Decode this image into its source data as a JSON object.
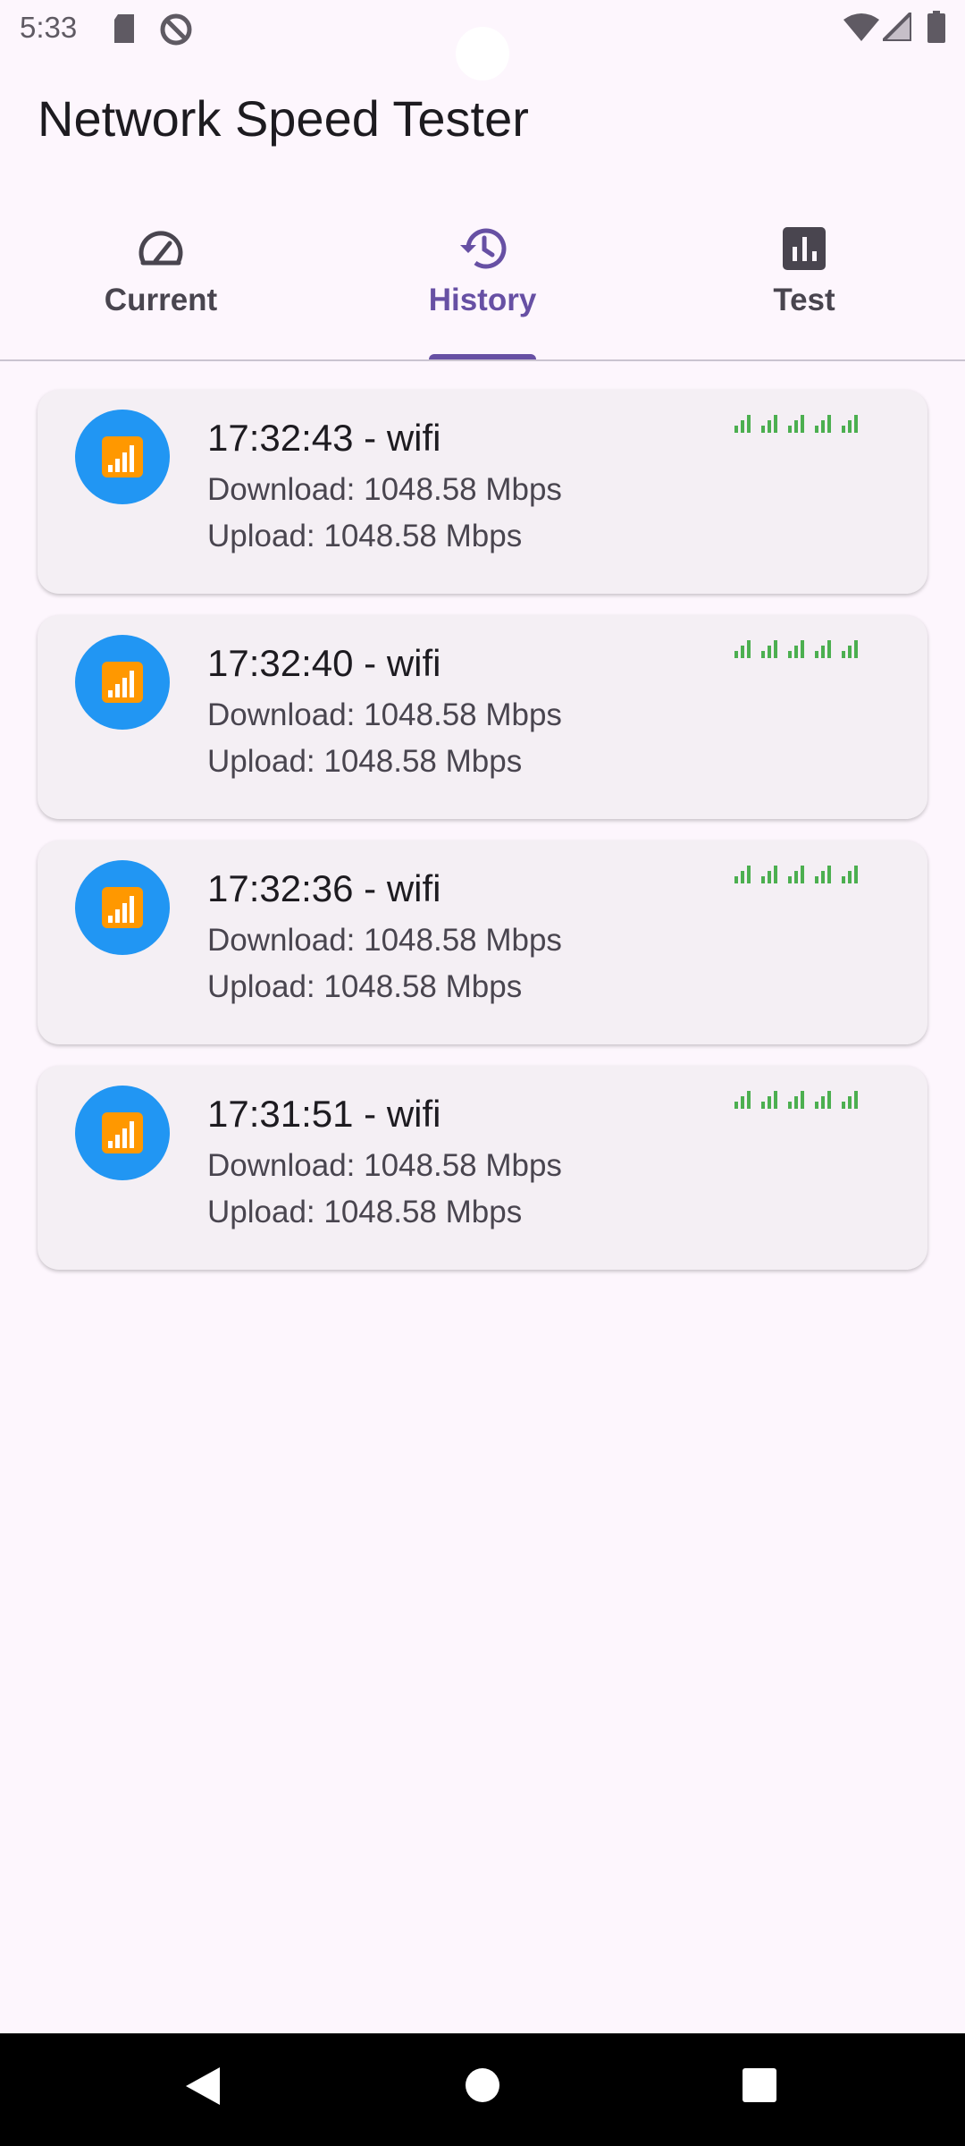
{
  "status_bar": {
    "time": "5:33",
    "icons": [
      "sd-card-icon",
      "do-not-disturb-icon",
      "wifi-icon",
      "cell-signal-icon",
      "battery-icon"
    ]
  },
  "app": {
    "title": "Network Speed Tester"
  },
  "tabs": [
    {
      "label": "Current",
      "icon": "speedometer-icon",
      "active": false
    },
    {
      "label": "History",
      "icon": "history-icon",
      "active": true
    },
    {
      "label": "Test",
      "icon": "bar-chart-icon",
      "active": false
    }
  ],
  "history": [
    {
      "title": "17:32:43 - wifi",
      "download": "Download: 1048.58 Mbps",
      "upload": "Upload: 1048.58 Mbps",
      "icon": "signal-bars-icon"
    },
    {
      "title": "17:32:40 - wifi",
      "download": "Download: 1048.58 Mbps",
      "upload": "Upload: 1048.58 Mbps",
      "icon": "signal-bars-icon"
    },
    {
      "title": "17:32:36 - wifi",
      "download": "Download: 1048.58 Mbps",
      "upload": "Upload: 1048.58 Mbps",
      "icon": "signal-bars-icon"
    },
    {
      "title": "17:31:51 - wifi",
      "download": "Download: 1048.58 Mbps",
      "upload": "Upload: 1048.58 Mbps",
      "icon": "signal-bars-icon"
    }
  ],
  "nav": {
    "buttons": [
      "back-icon",
      "home-icon",
      "recents-icon"
    ]
  },
  "colors": {
    "accent": "#6750a4",
    "avatar": "#2196f3",
    "signal": "#4caf50",
    "background": "#fdf6fd",
    "card": "#f4eff4"
  }
}
